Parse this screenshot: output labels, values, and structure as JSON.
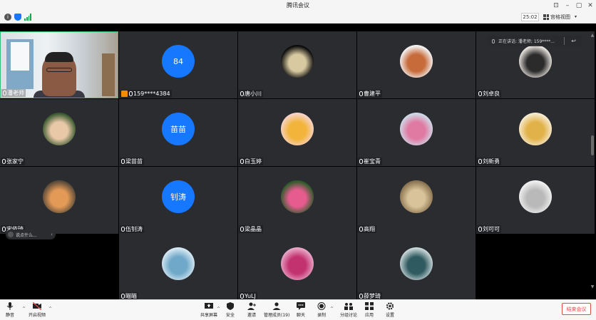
{
  "window": {
    "title": "腾讯会议"
  },
  "status_bar": {
    "timer": "25:02",
    "view_mode": "宫格视图"
  },
  "speaking_popup": {
    "text": "正在讲话: 潘老师; 159****...",
    "reply_icon": "reply-icon"
  },
  "chat_preview": {
    "text": "说点什么..."
  },
  "participants": [
    {
      "name": "潘老师",
      "type": "camera",
      "active": true
    },
    {
      "name": "159****4384",
      "type": "text",
      "avatar_text": "84",
      "host": true
    },
    {
      "name": "唐小川",
      "type": "photo",
      "colors": [
        "#0a0a0a",
        "#d8c9a0"
      ]
    },
    {
      "name": "曹建平",
      "type": "photo",
      "colors": [
        "#f3f3f3",
        "#c76b3a"
      ]
    },
    {
      "name": "刘卓良",
      "type": "photo",
      "colors": [
        "#e9e4df",
        "#2b2b2b"
      ]
    },
    {
      "name": "张家宁",
      "type": "photo",
      "colors": [
        "#3a5a30",
        "#e9c8a8"
      ]
    },
    {
      "name": "梁苗苗",
      "type": "text",
      "avatar_text": "苗苗"
    },
    {
      "name": "白玉婷",
      "type": "photo",
      "colors": [
        "#f7d3c8",
        "#f2b43a"
      ]
    },
    {
      "name": "崔宝青",
      "type": "photo",
      "colors": [
        "#cfd9e6",
        "#e07aa2"
      ]
    },
    {
      "name": "刘新勇",
      "type": "photo",
      "colors": [
        "#f6ead0",
        "#e2b24a"
      ]
    },
    {
      "name": "宋依琦",
      "type": "photo",
      "colors": [
        "#5a4a3a",
        "#e39a56"
      ]
    },
    {
      "name": "伍钊涛",
      "type": "text",
      "avatar_text": "钊涛"
    },
    {
      "name": "梁晶晶",
      "type": "photo",
      "colors": [
        "#2e5b2a",
        "#e65c8f"
      ]
    },
    {
      "name": "高翔",
      "type": "photo",
      "colors": [
        "#8a7350",
        "#d9c39a"
      ]
    },
    {
      "name": "刘可可",
      "type": "photo",
      "colors": [
        "#f0f0f0",
        "#b9b9b9"
      ]
    },
    {
      "name": "",
      "type": "empty"
    },
    {
      "name": "瞄瞄",
      "type": "photo",
      "colors": [
        "#d6e8f2",
        "#6fa8c8"
      ]
    },
    {
      "name": "YuLJ",
      "type": "photo",
      "colors": [
        "#e8a6c6",
        "#c2326f"
      ]
    },
    {
      "name": "薛梦琦",
      "type": "photo",
      "colors": [
        "#c9d6d8",
        "#2f5a5f"
      ]
    },
    {
      "name": "",
      "type": "empty"
    }
  ],
  "toolbar": {
    "mute": "静音",
    "video": "开启视频",
    "share": "共享屏幕",
    "security": "安全",
    "invite": "邀请",
    "members": "管理成员(19)",
    "chat": "聊天",
    "record": "录制",
    "breakout": "分组讨论",
    "apps": "应用",
    "settings": "设置",
    "end": "结束会议"
  },
  "colors": {
    "accent": "#1677ff",
    "active_border": "#2fbf71",
    "end": "#e34d4d",
    "tile_bg": "#2a2c30"
  }
}
